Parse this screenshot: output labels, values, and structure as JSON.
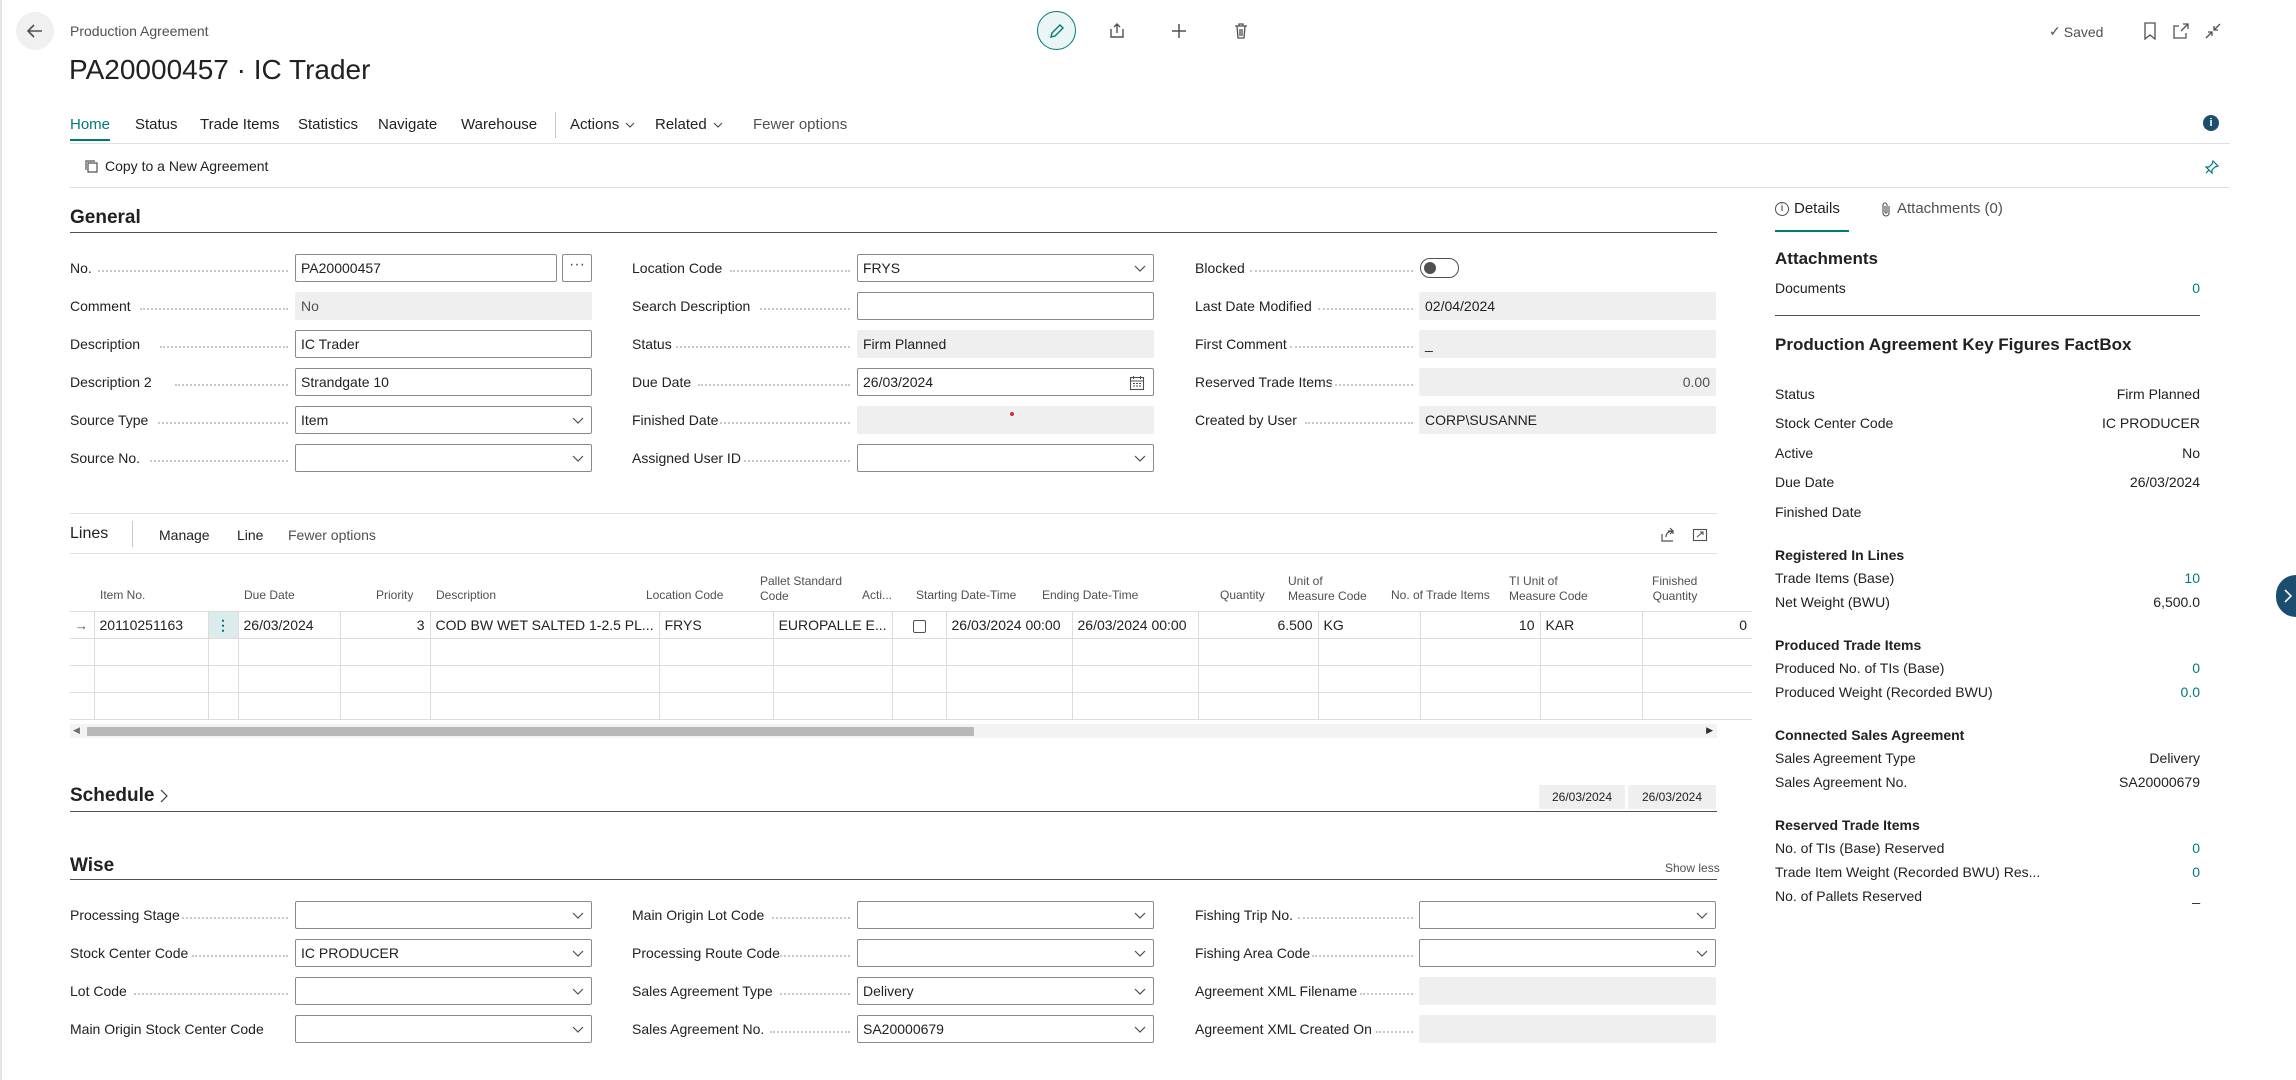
{
  "page": {
    "breadcrumb": "Production Agreement",
    "title": "PA20000457 · IC Trader",
    "saved_label": "Saved"
  },
  "nav": {
    "tabs": [
      "Home",
      "Status",
      "Trade Items",
      "Statistics",
      "Navigate",
      "Warehouse"
    ],
    "actions": "Actions",
    "related": "Related",
    "fewer": "Fewer options"
  },
  "actionbar": {
    "copy": "Copy to a New Agreement"
  },
  "general": {
    "title": "General",
    "no_label": "No.",
    "no_value": "PA20000457",
    "comment_label": "Comment",
    "comment_value": "No",
    "desc_label": "Description",
    "desc_value": "IC Trader",
    "desc2_label": "Description 2",
    "desc2_value": "Strandgate 10",
    "source_type_label": "Source Type",
    "source_type_value": "Item",
    "source_no_label": "Source No.",
    "source_no_value": "",
    "location_label": "Location Code",
    "location_value": "FRYS",
    "search_desc_label": "Search Description",
    "search_desc_value": "",
    "status_label": "Status",
    "status_value": "Firm Planned",
    "due_label": "Due Date",
    "due_value": "26/03/2024",
    "finished_label": "Finished Date",
    "finished_value": "",
    "assigned_label": "Assigned User ID",
    "assigned_value": "",
    "blocked_label": "Blocked",
    "last_mod_label": "Last Date Modified",
    "last_mod_value": "02/04/2024",
    "first_comment_label": "First Comment",
    "first_comment_value": "_",
    "reserved_label": "Reserved Trade Items",
    "reserved_value": "0.00",
    "created_label": "Created by User",
    "created_value": "CORP\\SUSANNE"
  },
  "lines": {
    "title": "Lines",
    "manage": "Manage",
    "line": "Line",
    "fewer": "Fewer options",
    "columns": {
      "item_no": "Item No.",
      "due": "Due Date",
      "priority": "Priority",
      "desc": "Description",
      "loc": "Location Code",
      "pallet1": "Pallet Standard",
      "pallet2": "Code",
      "active": "Acti...",
      "start": "Starting Date-Time",
      "end": "Ending Date-Time",
      "qty": "Quantity",
      "uom1": "Unit of",
      "uom2": "Measure Code",
      "ntrade": "No. of Trade Items",
      "tiuom1": "TI Unit of",
      "tiuom2": "Measure Code",
      "fin1": "Finished",
      "fin2": "Quantity"
    },
    "row": {
      "item_no": "20110251163",
      "due": "26/03/2024",
      "priority": "3",
      "desc": "COD BW WET SALTED 1-2.5 PL...",
      "loc": "FRYS",
      "pallet": "EUROPALLE E...",
      "start": "26/03/2024 00:00",
      "end": "26/03/2024 00:00",
      "qty": "6.500",
      "uom": "KG",
      "ntrade": "10",
      "tiuom": "KAR",
      "fin": "0"
    }
  },
  "schedule": {
    "title": "Schedule",
    "d1": "26/03/2024",
    "d2": "26/03/2024"
  },
  "wise": {
    "title": "Wise",
    "show_less": "Show less",
    "processing_stage_label": "Processing Stage",
    "processing_stage_value": "",
    "stock_center_label": "Stock Center Code",
    "stock_center_value": "IC PRODUCER",
    "lot_label": "Lot Code",
    "lot_value": "",
    "main_origin_sc_label": "Main Origin Stock Center Code",
    "main_origin_sc_value": "",
    "main_origin_lot_label": "Main Origin Lot Code",
    "main_origin_lot_value": "",
    "proc_route_label": "Processing Route Code",
    "proc_route_value": "",
    "sa_type_label": "Sales Agreement Type",
    "sa_type_value": "Delivery",
    "sa_no_label": "Sales Agreement No.",
    "sa_no_value": "SA20000679",
    "fishing_trip_label": "Fishing Trip No.",
    "fishing_trip_value": "",
    "fishing_area_label": "Fishing Area Code",
    "fishing_area_value": "",
    "xml_file_label": "Agreement XML Filename",
    "xml_file_value": "",
    "xml_created_label": "Agreement XML Created On",
    "xml_created_value": ""
  },
  "factbox": {
    "tab_details": "Details",
    "tab_attachments": "Attachments (0)",
    "attachments_title": "Attachments",
    "documents_label": "Documents",
    "documents_value": "0",
    "kf_title": "Production Agreement Key Figures FactBox",
    "status_label": "Status",
    "status_value": "Firm Planned",
    "sc_label": "Stock Center Code",
    "sc_value": "IC PRODUCER",
    "active_label": "Active",
    "active_value": "No",
    "due_label": "Due Date",
    "due_value": "26/03/2024",
    "fin_label": "Finished Date",
    "fin_value": "",
    "reg_head": "Registered In Lines",
    "ti_base_label": "Trade Items (Base)",
    "ti_base_value": "10",
    "nw_label": "Net Weight (BWU)",
    "nw_value": "6,500.0",
    "prod_head": "Produced Trade Items",
    "prod_no_label": "Produced No. of TIs (Base)",
    "prod_no_value": "0",
    "prod_w_label": "Produced Weight (Recorded BWU)",
    "prod_w_value": "0.0",
    "conn_head": "Connected Sales Agreement",
    "sat_label": "Sales Agreement Type",
    "sat_value": "Delivery",
    "san_label": "Sales Agreement No.",
    "san_value": "SA20000679",
    "res_head": "Reserved Trade Items",
    "res_no_label": "No. of TIs (Base) Reserved",
    "res_no_value": "0",
    "res_w_label": "Trade Item Weight (Recorded BWU) Res...",
    "res_w_value": "0",
    "res_p_label": "No. of Pallets Reserved",
    "res_p_value": "_"
  },
  "colors": {
    "accent": "#00797c",
    "border": "#8a8a8a",
    "readonly": "#efefef"
  }
}
